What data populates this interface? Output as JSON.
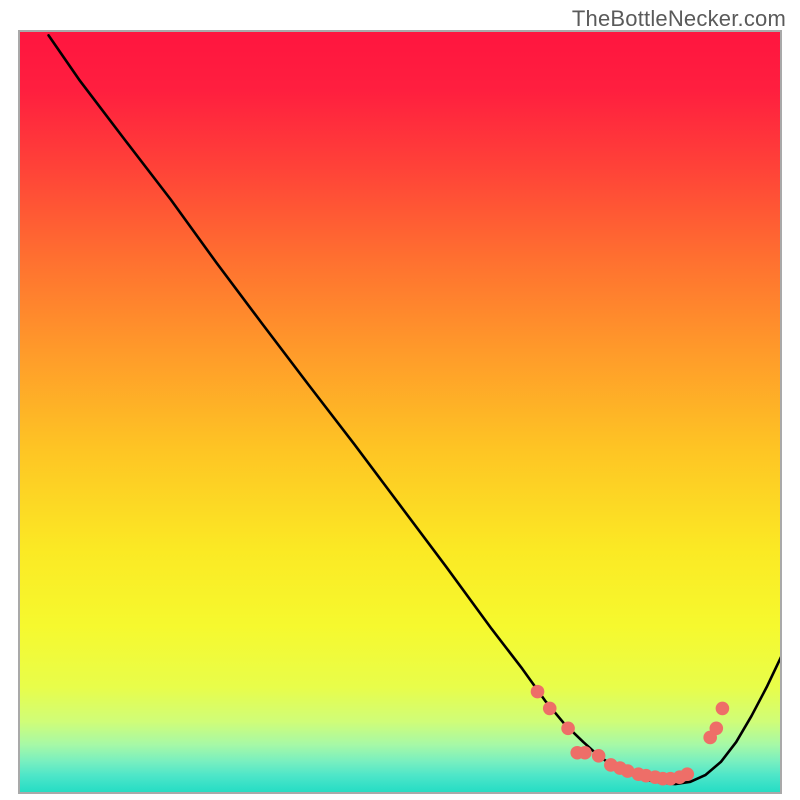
{
  "attribution": "TheBottleNecker.com",
  "chart_data": {
    "type": "line",
    "title": "",
    "xlabel": "",
    "ylabel": "",
    "xlim": [
      0,
      100
    ],
    "ylim": [
      0,
      100
    ],
    "grid": false,
    "background_gradient": {
      "stops": [
        {
          "offset": 0.0,
          "color": "#ff153f"
        },
        {
          "offset": 0.08,
          "color": "#ff1f3f"
        },
        {
          "offset": 0.18,
          "color": "#ff4238"
        },
        {
          "offset": 0.3,
          "color": "#ff7030"
        },
        {
          "offset": 0.42,
          "color": "#ff9a2a"
        },
        {
          "offset": 0.55,
          "color": "#fec524"
        },
        {
          "offset": 0.68,
          "color": "#fbe924"
        },
        {
          "offset": 0.78,
          "color": "#f6f92e"
        },
        {
          "offset": 0.86,
          "color": "#e8fd4a"
        },
        {
          "offset": 0.905,
          "color": "#d0fd78"
        },
        {
          "offset": 0.935,
          "color": "#a7f9a6"
        },
        {
          "offset": 0.958,
          "color": "#77efc0"
        },
        {
          "offset": 0.975,
          "color": "#4fe6c8"
        },
        {
          "offset": 0.992,
          "color": "#2fdfc6"
        },
        {
          "offset": 1.0,
          "color": "#23dcc1"
        }
      ]
    },
    "series": [
      {
        "name": "bottleneck-curve",
        "x": [
          4,
          8,
          14,
          20,
          26,
          32,
          38,
          44,
          50,
          56,
          62,
          66,
          69,
          71.5,
          74,
          76,
          78,
          80,
          82,
          84,
          86,
          88,
          90,
          92,
          94,
          96,
          98,
          100
        ],
        "y": [
          99.3,
          93.5,
          85.6,
          77.8,
          69.5,
          61.5,
          53.6,
          45.8,
          37.8,
          29.8,
          21.6,
          16.4,
          12.2,
          9.2,
          6.8,
          5.0,
          3.6,
          2.6,
          1.9,
          1.5,
          1.3,
          1.6,
          2.5,
          4.2,
          6.8,
          10.2,
          14.0,
          18.2
        ]
      }
    ],
    "markers": {
      "name": "highlight-dots",
      "points": [
        {
          "x": 68.0,
          "y": 13.4
        },
        {
          "x": 69.6,
          "y": 11.2
        },
        {
          "x": 72.0,
          "y": 8.6
        },
        {
          "x": 73.2,
          "y": 5.4
        },
        {
          "x": 74.2,
          "y": 5.4
        },
        {
          "x": 76.0,
          "y": 5.0
        },
        {
          "x": 77.6,
          "y": 3.8
        },
        {
          "x": 78.8,
          "y": 3.4
        },
        {
          "x": 79.8,
          "y": 3.0
        },
        {
          "x": 81.2,
          "y": 2.6
        },
        {
          "x": 82.2,
          "y": 2.4
        },
        {
          "x": 83.4,
          "y": 2.2
        },
        {
          "x": 84.4,
          "y": 2.0
        },
        {
          "x": 85.4,
          "y": 2.0
        },
        {
          "x": 86.6,
          "y": 2.2
        },
        {
          "x": 87.6,
          "y": 2.6
        },
        {
          "x": 90.6,
          "y": 7.4
        },
        {
          "x": 91.4,
          "y": 8.6
        },
        {
          "x": 92.2,
          "y": 11.2
        }
      ]
    }
  }
}
